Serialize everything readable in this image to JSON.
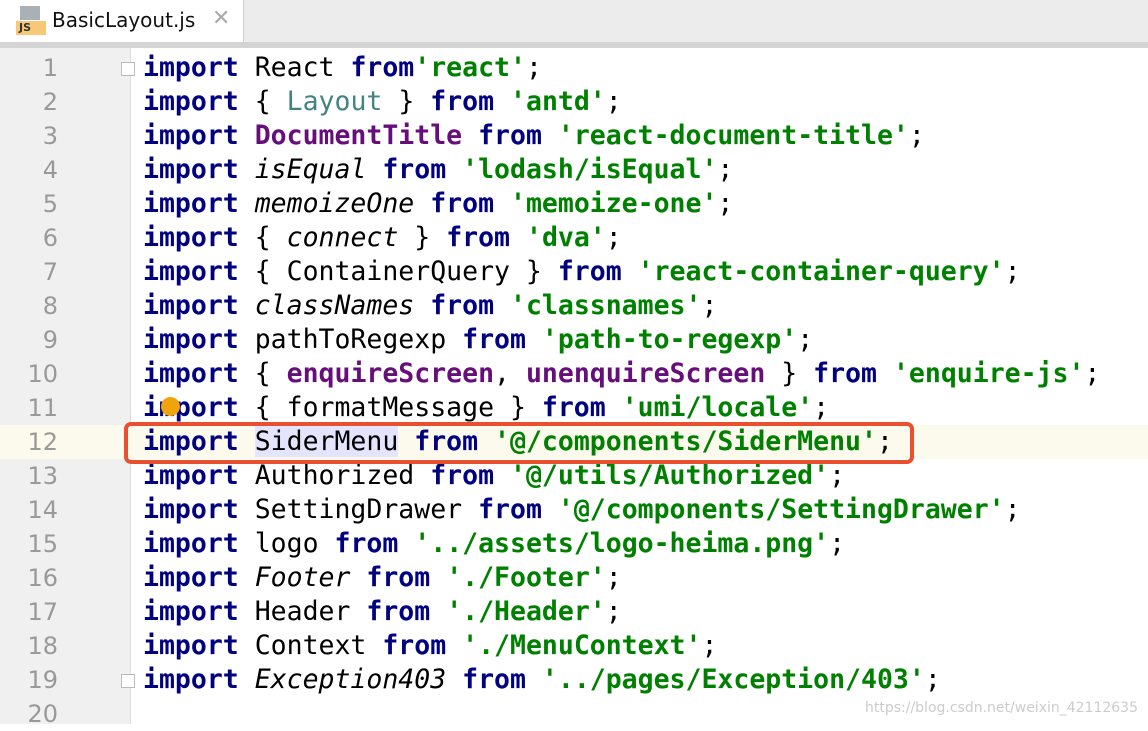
{
  "tab": {
    "name": "BasicLayout.js",
    "icon": "js-file-icon",
    "icon_label": "JS",
    "close": "✕"
  },
  "current_line": 12,
  "lines": [
    [
      [
        "kw",
        "import"
      ],
      [
        "",
        "React "
      ],
      [
        "kw",
        "from"
      ],
      [
        "",
        ""
      ],
      [
        "str",
        "'react'"
      ],
      [
        "",
        ";"
      ]
    ],
    [
      [
        "kw",
        "import"
      ],
      [
        "",
        "{ "
      ],
      [
        "te",
        "Layout"
      ],
      [
        "",
        " } "
      ],
      [
        "kw",
        "from"
      ],
      [
        "str",
        "'antd'"
      ],
      [
        "",
        ";"
      ]
    ],
    [
      [
        "kw",
        "import"
      ],
      [
        "pu",
        "DocumentTitle"
      ],
      [
        "",
        ""
      ],
      [
        "kw",
        " from"
      ],
      [
        "str",
        "'react-document-title'"
      ],
      [
        "",
        ";"
      ]
    ],
    [
      [
        "kw",
        "import"
      ],
      [
        "it",
        "isEqual"
      ],
      [
        "kw",
        " from"
      ],
      [
        "str",
        "'lodash/isEqual'"
      ],
      [
        "",
        ";"
      ]
    ],
    [
      [
        "kw",
        "import"
      ],
      [
        "it",
        "memoizeOne"
      ],
      [
        "kw",
        " from"
      ],
      [
        "str",
        "'memoize-one'"
      ],
      [
        "",
        ";"
      ]
    ],
    [
      [
        "kw",
        "import"
      ],
      [
        "",
        "{ "
      ],
      [
        "it",
        "connect"
      ],
      [
        "",
        " } "
      ],
      [
        "kw",
        "from"
      ],
      [
        "str",
        "'dva'"
      ],
      [
        "",
        ";"
      ]
    ],
    [
      [
        "kw",
        "import"
      ],
      [
        "",
        "{ ContainerQuery } "
      ],
      [
        "kw",
        "from"
      ],
      [
        "str",
        "'react-container-query'"
      ],
      [
        "",
        ";"
      ]
    ],
    [
      [
        "kw",
        "import"
      ],
      [
        "it",
        "classNames"
      ],
      [
        "kw",
        " from"
      ],
      [
        "str",
        "'classnames'"
      ],
      [
        "",
        ";"
      ]
    ],
    [
      [
        "kw",
        "import"
      ],
      [
        "",
        "pathToRegexp "
      ],
      [
        "kw",
        "from"
      ],
      [
        "str",
        "'path-to-regexp'"
      ],
      [
        "",
        ";"
      ]
    ],
    [
      [
        "kw",
        "import"
      ],
      [
        "",
        "{ "
      ],
      [
        "pu",
        "enquireScreen"
      ],
      [
        "",
        ", "
      ],
      [
        "pu",
        "unenquireScreen"
      ],
      [
        "",
        " } "
      ],
      [
        "kw",
        "from"
      ],
      [
        "str",
        "'enquire-js'"
      ],
      [
        "",
        ";"
      ]
    ],
    [
      [
        "kw",
        "import"
      ],
      [
        "",
        "{ formatMessage } "
      ],
      [
        "kw",
        "from"
      ],
      [
        "str",
        "'umi/locale'"
      ],
      [
        "",
        ";"
      ]
    ],
    [
      [
        "kw",
        "import"
      ],
      [
        "sel",
        "SiderMenu"
      ],
      [
        "kw",
        " from"
      ],
      [
        "str",
        "'@/components/SiderMenu'"
      ],
      [
        "",
        ";"
      ]
    ],
    [
      [
        "kw",
        "import"
      ],
      [
        "",
        "Authorized "
      ],
      [
        "kw",
        "from"
      ],
      [
        "str",
        "'@/utils/Authorized'"
      ],
      [
        "",
        ";"
      ]
    ],
    [
      [
        "kw",
        "import"
      ],
      [
        "",
        "SettingDrawer "
      ],
      [
        "kw",
        "from"
      ],
      [
        "str",
        "'@/components/SettingDrawer'"
      ],
      [
        "",
        ";"
      ]
    ],
    [
      [
        "kw",
        "import"
      ],
      [
        "",
        "logo "
      ],
      [
        "kw",
        "from"
      ],
      [
        "str",
        "'../assets/logo-heima.png'"
      ],
      [
        "",
        ";"
      ]
    ],
    [
      [
        "kw",
        "import"
      ],
      [
        "it",
        "Footer"
      ],
      [
        "kw",
        " from"
      ],
      [
        "str",
        "'./Footer'"
      ],
      [
        "",
        ";"
      ]
    ],
    [
      [
        "kw",
        "import"
      ],
      [
        "",
        "Header "
      ],
      [
        "kw",
        "from"
      ],
      [
        "str",
        "'./Header'"
      ],
      [
        "",
        ";"
      ]
    ],
    [
      [
        "kw",
        "import"
      ],
      [
        "",
        "Context "
      ],
      [
        "kw",
        "from"
      ],
      [
        "str",
        "'./MenuContext'"
      ],
      [
        "",
        ";"
      ]
    ],
    [
      [
        "kw",
        "import"
      ],
      [
        "it",
        "Exception403"
      ],
      [
        "kw",
        " from"
      ],
      [
        "str",
        "'../pages/Exception/403'"
      ],
      [
        "",
        ";"
      ]
    ],
    []
  ],
  "watermark": "https://blog.csdn.net/weixin_42112635",
  "colors": {
    "keyword": "#000080",
    "string": "#008000",
    "highlight_box": "#e8502f",
    "current_line": "#fcfaed"
  }
}
